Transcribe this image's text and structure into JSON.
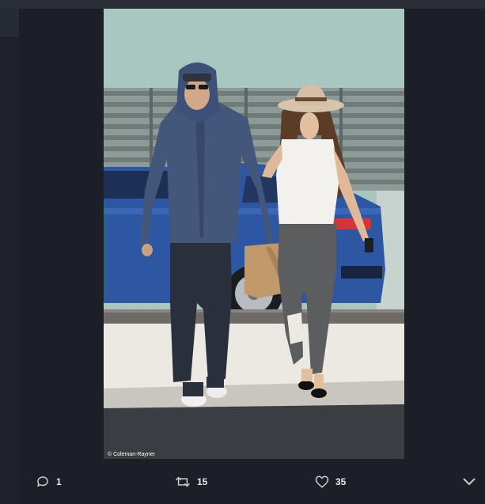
{
  "photo": {
    "credit": "© Coleman-Rayner"
  },
  "actions": {
    "reply": {
      "icon": "reply-icon",
      "count": "1"
    },
    "retweet": {
      "icon": "retweet-icon",
      "count": "15"
    },
    "like": {
      "icon": "heart-icon",
      "count": "35"
    },
    "more": {
      "icon": "chevron-down-icon"
    }
  },
  "colors": {
    "background": "#14171a",
    "panel": "#1c2026",
    "icon": "#c9cdd2",
    "count_text": "#e6e9ec"
  }
}
